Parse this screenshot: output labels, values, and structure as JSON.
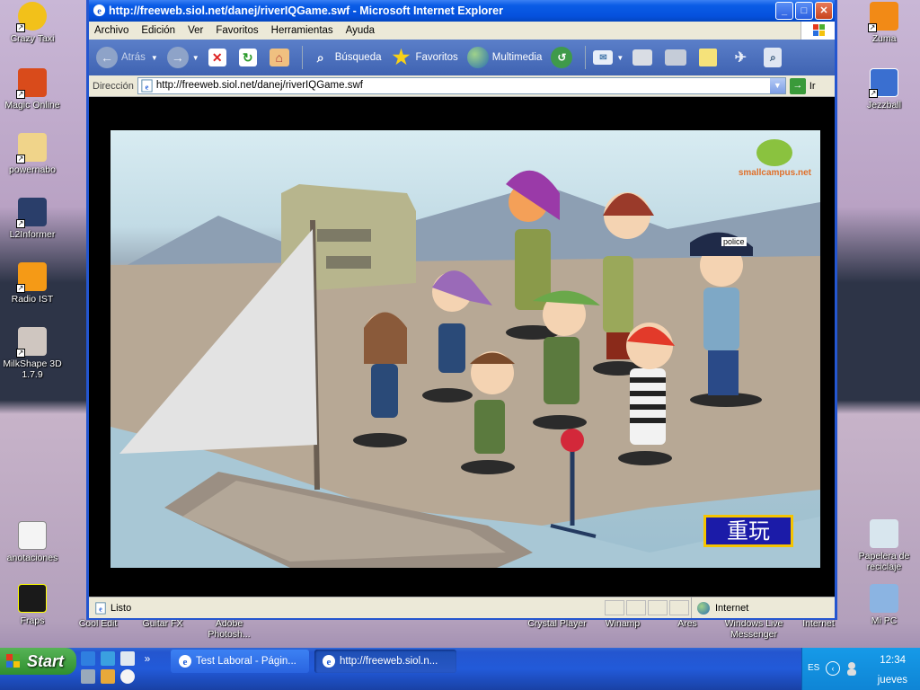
{
  "desktop": {
    "icons_left": [
      {
        "label": "Crazy Taxi",
        "color": "#f2c11a"
      },
      {
        "label": "Magic Online",
        "color": "#d94b1b"
      },
      {
        "label": "powernabo",
        "color": "#f0d48a"
      },
      {
        "label": "L2Informer",
        "color": "#2a3e6a"
      },
      {
        "label": "Radio IST",
        "color": "#f59a16"
      },
      {
        "label": "MilkShape 3D 1.7.9",
        "color": "#cfc6c0"
      },
      {
        "label": "anotaciones",
        "color": "#f4f4f4"
      },
      {
        "label": "Fraps",
        "color": "#1a1a1a"
      }
    ],
    "icons_right": [
      {
        "label": "Zuma",
        "color": "#f28a16"
      },
      {
        "label": "Jezzball",
        "color": "#3a6fd0"
      },
      {
        "label": "Papelera de reciclaje",
        "color": "#d8e6ee"
      },
      {
        "label": "Mi PC",
        "color": "#8bb4e2"
      }
    ],
    "icons_bottom_partial": [
      "Cool Edit",
      "Guitar FX",
      "Adobe Photosh...",
      "Crystal Player",
      "Winamp",
      "Ares",
      "Windows Live Messenger",
      "Internet"
    ]
  },
  "window": {
    "title": "http://freeweb.siol.net/danej/riverIQGame.swf - Microsoft Internet Explorer",
    "menu": [
      "Archivo",
      "Edición",
      "Ver",
      "Favoritos",
      "Herramientas",
      "Ayuda"
    ],
    "toolbar": {
      "back": "Atrás",
      "search": "Búsqueda",
      "favorites": "Favoritos",
      "media": "Multimedia"
    },
    "address": {
      "label": "Dirección",
      "url": "http://freeweb.siol.net/danej/riverIQGame.swf",
      "go": "Ir"
    },
    "status": {
      "text": "Listo",
      "zone": "Internet"
    }
  },
  "game": {
    "logo_url": "smallcampus.net",
    "replay_button": "重玩",
    "police_label": "police"
  },
  "taskbar": {
    "start": "Start",
    "tasks": [
      {
        "label": "Test Laboral - Págin...",
        "active": false
      },
      {
        "label": "http://freeweb.siol.n...",
        "active": true
      }
    ],
    "tray": {
      "lang": "ES",
      "time": "12:34",
      "day": "jueves"
    }
  }
}
